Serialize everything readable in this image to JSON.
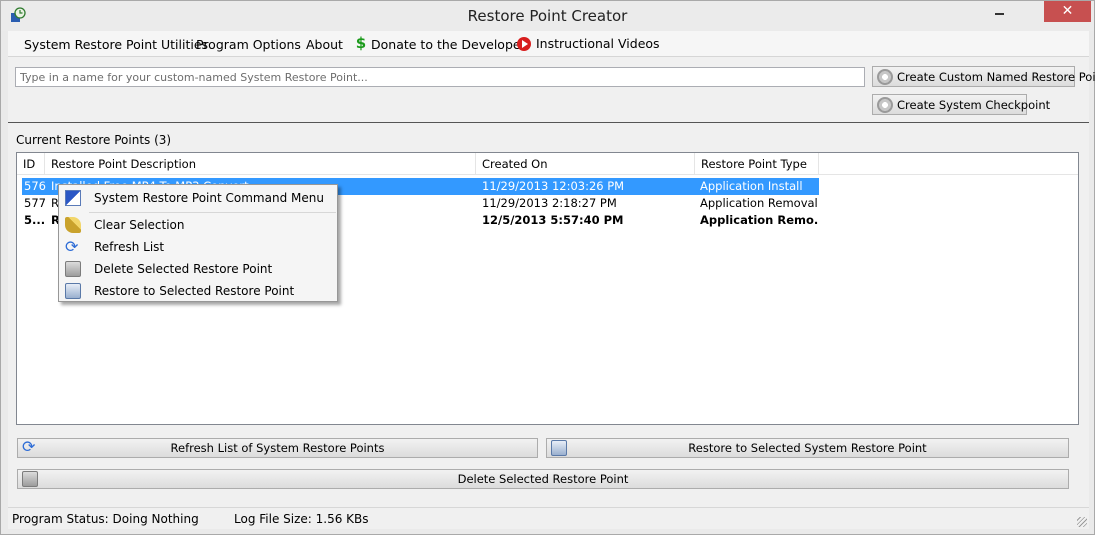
{
  "window": {
    "title": "Restore Point Creator"
  },
  "titlebar_buttons": {
    "minimize": "",
    "close": "✕"
  },
  "menubar": {
    "items": [
      {
        "label": "System Restore Point Utilities"
      },
      {
        "label": "Program Options"
      },
      {
        "label": "About"
      },
      {
        "label": "Donate to the Developer",
        "icon": "dollar-icon"
      },
      {
        "label": "Instructional Videos",
        "icon": "play-icon"
      }
    ]
  },
  "name_input": {
    "placeholder": "Type in a name for your custom-named System Restore Point...",
    "value": ""
  },
  "buttons": {
    "create_custom": "Create Custom Named Restore Point",
    "create_checkpoint": "Create System Checkpoint",
    "refresh_list": "Refresh List of System Restore Points",
    "restore_selected": "Restore to Selected System Restore Point",
    "delete_selected": "Delete Selected Restore Point"
  },
  "restore_points": {
    "section_label": "Current Restore Points (3)",
    "columns": [
      "ID",
      "Restore Point Description",
      "Created On",
      "Restore Point Type"
    ],
    "rows": [
      {
        "id": "576",
        "description": "Installed Free MP4 To MP3 Convert...",
        "created": "11/29/2013 12:03:26 PM",
        "type": "Application Install"
      },
      {
        "id": "577",
        "description": "R",
        "created": "11/29/2013 2:18:27 PM",
        "type": "Application Removal"
      },
      {
        "id": "5...",
        "description": "R",
        "created": "12/5/2013 5:57:40 PM",
        "type": "Application Remo..."
      }
    ]
  },
  "context_menu": {
    "items": [
      {
        "label": "System Restore Point Command Menu",
        "icon": "command-menu-icon"
      },
      {
        "label": "Clear Selection",
        "icon": "broom-icon"
      },
      {
        "label": "Refresh List",
        "icon": "refresh-icon"
      },
      {
        "label": "Delete Selected Restore Point",
        "icon": "trash-icon"
      },
      {
        "label": "Restore to Selected Restore Point",
        "icon": "restore-icon"
      }
    ]
  },
  "status": {
    "program_status": "Program Status:  Doing Nothing",
    "log_file_size": "Log File Size:  1.56 KBs"
  },
  "colors": {
    "selection": "#3399ff",
    "close_button": "#c75050"
  }
}
